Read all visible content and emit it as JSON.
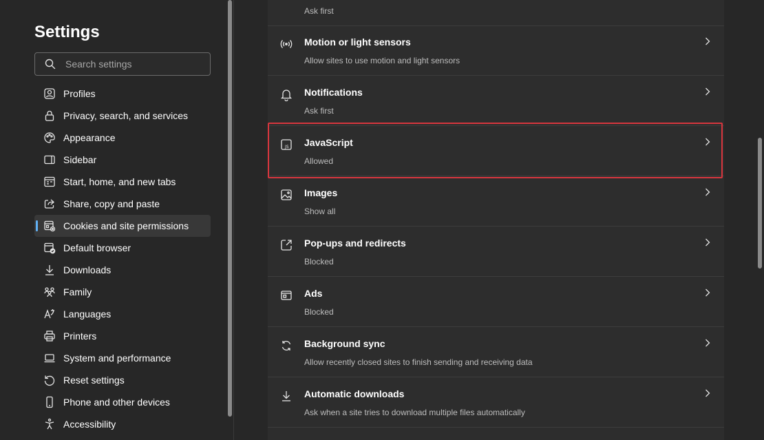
{
  "sidebar": {
    "title": "Settings",
    "search_placeholder": "Search settings",
    "items": [
      {
        "label": "Profiles",
        "icon": "profile-icon"
      },
      {
        "label": "Privacy, search, and services",
        "icon": "lock-icon"
      },
      {
        "label": "Appearance",
        "icon": "palette-icon"
      },
      {
        "label": "Sidebar",
        "icon": "sidebar-icon"
      },
      {
        "label": "Start, home, and new tabs",
        "icon": "home-tab-icon"
      },
      {
        "label": "Share, copy and paste",
        "icon": "share-icon"
      },
      {
        "label": "Cookies and site permissions",
        "icon": "cookies-icon",
        "selected": true
      },
      {
        "label": "Default browser",
        "icon": "default-browser-icon"
      },
      {
        "label": "Downloads",
        "icon": "download-icon"
      },
      {
        "label": "Family",
        "icon": "family-icon"
      },
      {
        "label": "Languages",
        "icon": "languages-icon"
      },
      {
        "label": "Printers",
        "icon": "printer-icon"
      },
      {
        "label": "System and performance",
        "icon": "laptop-icon"
      },
      {
        "label": "Reset settings",
        "icon": "reset-icon"
      },
      {
        "label": "Phone and other devices",
        "icon": "phone-icon"
      },
      {
        "label": "Accessibility",
        "icon": "accessibility-icon"
      }
    ]
  },
  "permissions": {
    "partial_sub": "Ask first",
    "rows": [
      {
        "title": "Motion or light sensors",
        "sub": "Allow sites to use motion and light sensors",
        "icon": "sensor-icon"
      },
      {
        "title": "Notifications",
        "sub": "Ask first",
        "icon": "bell-icon"
      },
      {
        "title": "JavaScript",
        "sub": "Allowed",
        "icon": "javascript-icon"
      },
      {
        "title": "Images",
        "sub": "Show all",
        "icon": "image-icon"
      },
      {
        "title": "Pop-ups and redirects",
        "sub": "Blocked",
        "icon": "popup-icon"
      },
      {
        "title": "Ads",
        "sub": "Blocked",
        "icon": "ads-icon"
      },
      {
        "title": "Background sync",
        "sub": "Allow recently closed sites to finish sending and receiving data",
        "icon": "sync-icon"
      },
      {
        "title": "Automatic downloads",
        "sub": "Ask when a site tries to download multiple files automatically",
        "icon": "download-icon"
      }
    ]
  },
  "colors": {
    "accent": "#60b0f4",
    "highlight": "#d9363e",
    "background": "#272727",
    "panel": "#2d2d2d"
  }
}
